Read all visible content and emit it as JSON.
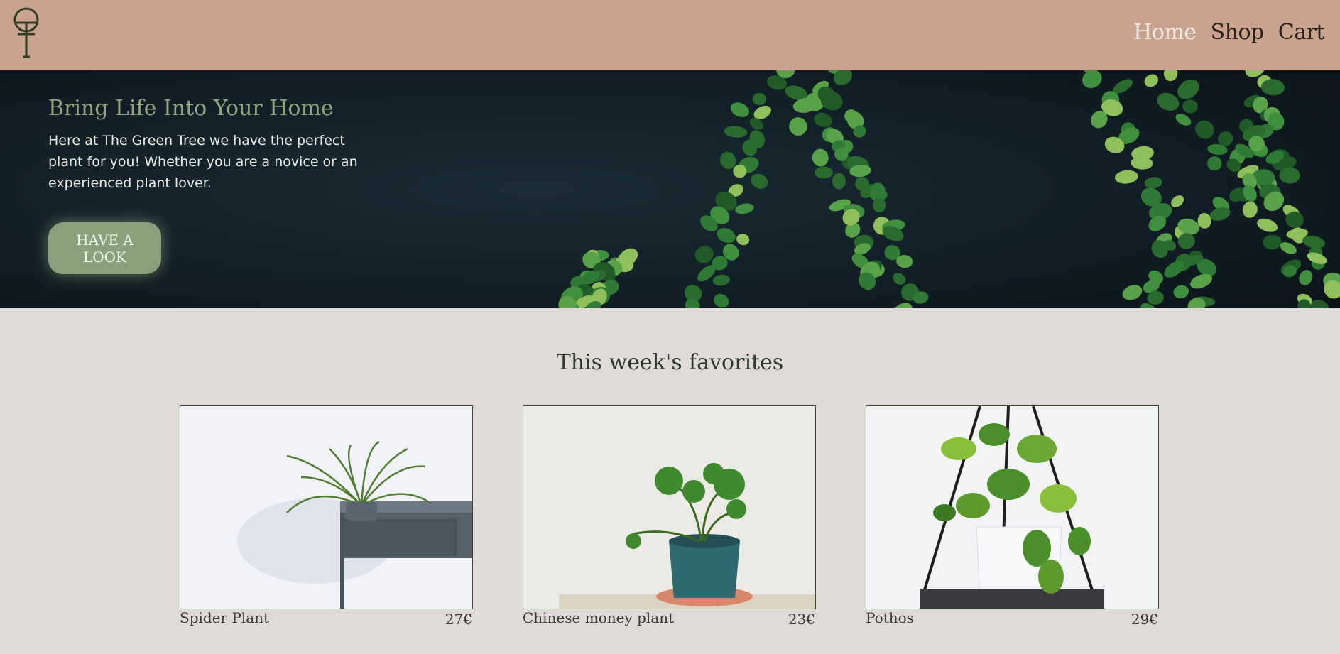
{
  "header": {
    "logo": "tree-logo-icon",
    "nav": [
      {
        "label": "Home",
        "active": true
      },
      {
        "label": "Shop",
        "active": false
      },
      {
        "label": "Cart",
        "active": false
      }
    ]
  },
  "hero": {
    "title": "Bring Life Into Your Home",
    "text": "Here at The Green Tree we have the perfect plant for you! Whether you are a novice or an experienced plant lover.",
    "button": "HAVE A LOOK"
  },
  "favorites": {
    "title": "This week's favorites",
    "products": [
      {
        "name": "Spider Plant",
        "price": "27€"
      },
      {
        "name": "Chinese money plant",
        "price": "23€"
      },
      {
        "name": "Pothos",
        "price": "29€"
      }
    ]
  },
  "colors": {
    "header_bg": "#caa390",
    "page_bg": "#dfdad7",
    "accent_green": "#88a17c",
    "hero_bg": "#0f1d24"
  }
}
